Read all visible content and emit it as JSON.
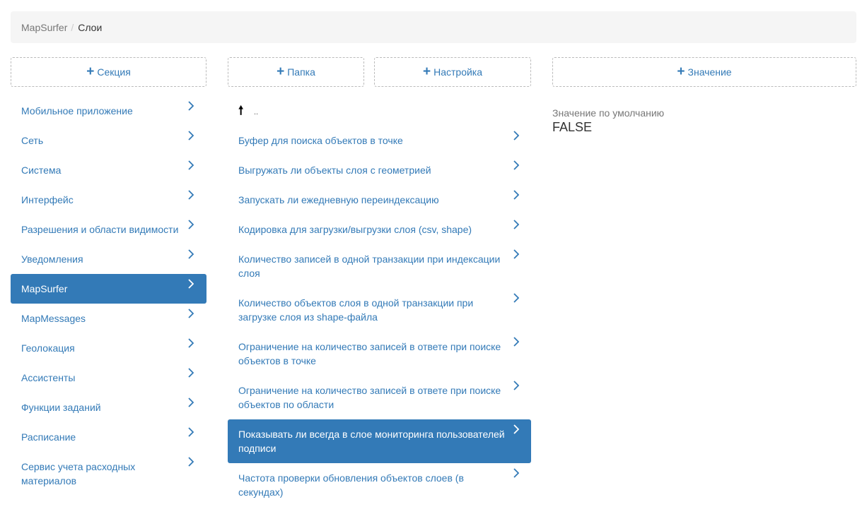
{
  "breadcrumb": {
    "root": "MapSurfer",
    "separator": "/",
    "current": "Слои"
  },
  "buttons": {
    "section": "Секция",
    "folder": "Папка",
    "setting": "Настройка",
    "value": "Значение"
  },
  "sections": [
    {
      "label": "Мобильное приложение",
      "active": false
    },
    {
      "label": "Сеть",
      "active": false
    },
    {
      "label": "Система",
      "active": false
    },
    {
      "label": "Интерфейс",
      "active": false
    },
    {
      "label": "Разрешения и области видимости",
      "active": false
    },
    {
      "label": "Уведомления",
      "active": false
    },
    {
      "label": "MapSurfer",
      "active": true
    },
    {
      "label": "MapMessages",
      "active": false
    },
    {
      "label": "Геолокация",
      "active": false
    },
    {
      "label": "Ассистенты",
      "active": false
    },
    {
      "label": "Функции заданий",
      "active": false
    },
    {
      "label": "Расписание",
      "active": false
    },
    {
      "label": "Сервис учета расходных материалов",
      "active": false
    }
  ],
  "up_item": {
    "icon": "arrow-up-icon",
    "label": ".."
  },
  "settings": [
    {
      "label": "Буфер для поиска объектов в точке",
      "active": false
    },
    {
      "label": "Выгружать ли объекты слоя с геометрией",
      "active": false
    },
    {
      "label": "Запускать ли ежедневную переиндексацию",
      "active": false
    },
    {
      "label": "Кодировка для загрузки/выгрузки слоя (csv, shape)",
      "active": false
    },
    {
      "label": "Количество записей в одной транзакции при индексации слоя",
      "active": false
    },
    {
      "label": "Количество объектов слоя в одной транзакции при загрузке слоя из shape-файла",
      "active": false
    },
    {
      "label": "Ограничение на количество записей в ответе при поиске объектов в точке",
      "active": false
    },
    {
      "label": "Ограничение на количество записей в ответе при поиске объектов по области",
      "active": false
    },
    {
      "label": "Показывать ли всегда в слое мониторинга пользователей подписи",
      "active": true
    },
    {
      "label": "Частота проверки обновления объектов слоев (в секундах)",
      "active": false
    }
  ],
  "value_panel": {
    "label": "Значение по умолчанию",
    "value": "FALSE"
  },
  "colors": {
    "accent": "#337ab7",
    "breadcrumb_bg": "#f5f5f5",
    "muted": "#777777"
  }
}
